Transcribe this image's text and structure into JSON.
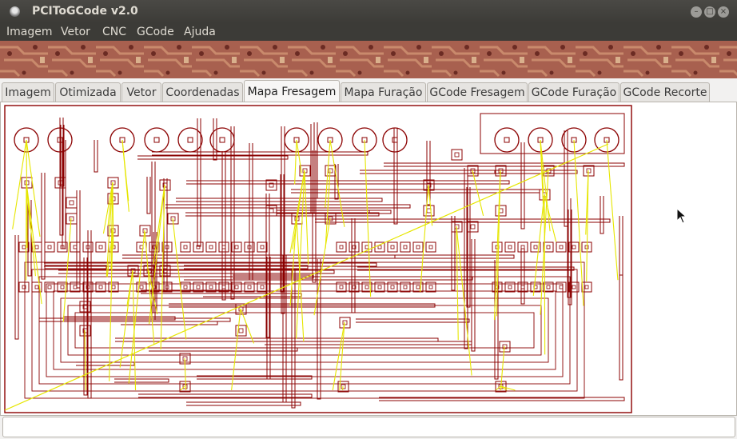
{
  "window": {
    "title": "PCIToGCode  v2.0",
    "controls": [
      "minimize",
      "maximize",
      "close"
    ]
  },
  "menu": [
    "Imagem",
    "Vetor",
    "CNC",
    "GCode",
    "Ajuda"
  ],
  "tabs": [
    {
      "label": "Imagem",
      "active": false
    },
    {
      "label": "Otimizada",
      "active": false
    },
    {
      "label": "Vetor",
      "active": false
    },
    {
      "label": "Coordenadas",
      "active": false
    },
    {
      "label": "Mapa Fresagem",
      "active": true
    },
    {
      "label": "Mapa Furação",
      "active": false
    },
    {
      "label": "GCode Fresagem",
      "active": false
    },
    {
      "label": "GCode Furação",
      "active": false
    },
    {
      "label": "GCode Recorte",
      "active": false
    }
  ],
  "colors": {
    "titlebar": "#3c3b37",
    "trace": "#8b0000",
    "travel": "#e6e600",
    "banner": "#a0584a"
  },
  "icons": {
    "window_icon": "app-icon",
    "cursor": "mouse-pointer-icon"
  },
  "status": ""
}
